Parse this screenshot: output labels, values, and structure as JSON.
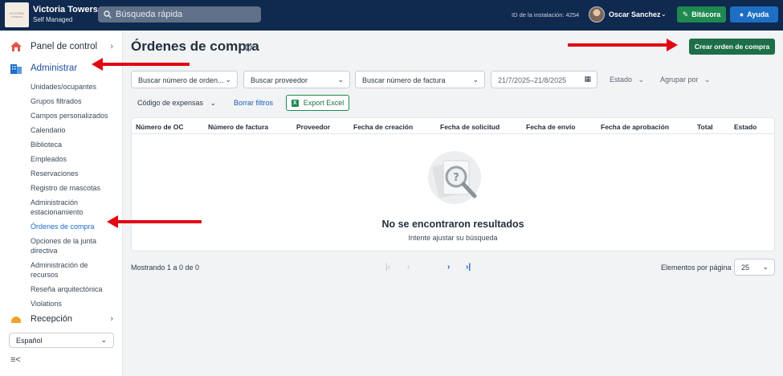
{
  "header": {
    "app_name": "Victoria Towers",
    "app_sub": "Self Managed",
    "search_placeholder": "Búsqueda rápida",
    "installation_id": "ID de la instalación: 4254",
    "user_name": "Oscar Sanchez",
    "bitacora_label": "Bitácora",
    "ayuda_label": "Ayuda"
  },
  "sidebar": {
    "top_item": "Panel de control",
    "section": "Administrar",
    "items": [
      {
        "label": "Unidades/ocupantes"
      },
      {
        "label": "Grupos filtrados"
      },
      {
        "label": "Campos personalizados"
      },
      {
        "label": "Calendario"
      },
      {
        "label": "Biblioteca"
      },
      {
        "label": "Empleados"
      },
      {
        "label": "Reservaciones"
      },
      {
        "label": "Registro de mascotas"
      },
      {
        "label": "Administración estacionamiento"
      },
      {
        "label": "Órdenes de compra",
        "active": true
      },
      {
        "label": "Opciones de la junta directiva"
      },
      {
        "label": "Administración de recursos"
      },
      {
        "label": "Reseña arquitectónica"
      },
      {
        "label": "Violations"
      }
    ],
    "next_section": "Recepción",
    "language": "Español"
  },
  "page": {
    "title": "Órdenes de compra",
    "create_button": "Crear orden de compra"
  },
  "filters": {
    "po_placeholder": "Buscar número de orden...",
    "vendor_placeholder": "Buscar proveedor",
    "invoice_placeholder": "Buscar número de factura",
    "date_range": "21/7/2025–21/8/2025",
    "status": "Estado",
    "group_by": "Agrupar por",
    "expense_code": "Código de expensas",
    "clear_filters": "Borrar filtros",
    "export_excel": "Export Excel"
  },
  "table": {
    "columns": [
      "Número de OC",
      "Número de factura",
      "Proveedor",
      "Fecha de creación",
      "Fecha de solicitud",
      "Fecha de envío",
      "Fecha de aprobación",
      "Total",
      "Estado"
    ],
    "rows": [],
    "empty_title": "No se encontraron resultados",
    "empty_sub": "Intente ajustar su búsqueda"
  },
  "pagination": {
    "summary": "Mostrando 1 a 0 de 0",
    "per_page_label": "Elementos por página",
    "per_page_value": "25"
  },
  "colors": {
    "topbar": "#10294f",
    "create_button": "#1e6e47",
    "active_link": "#1b6ac9",
    "annotation_arrow": "#e30613"
  }
}
